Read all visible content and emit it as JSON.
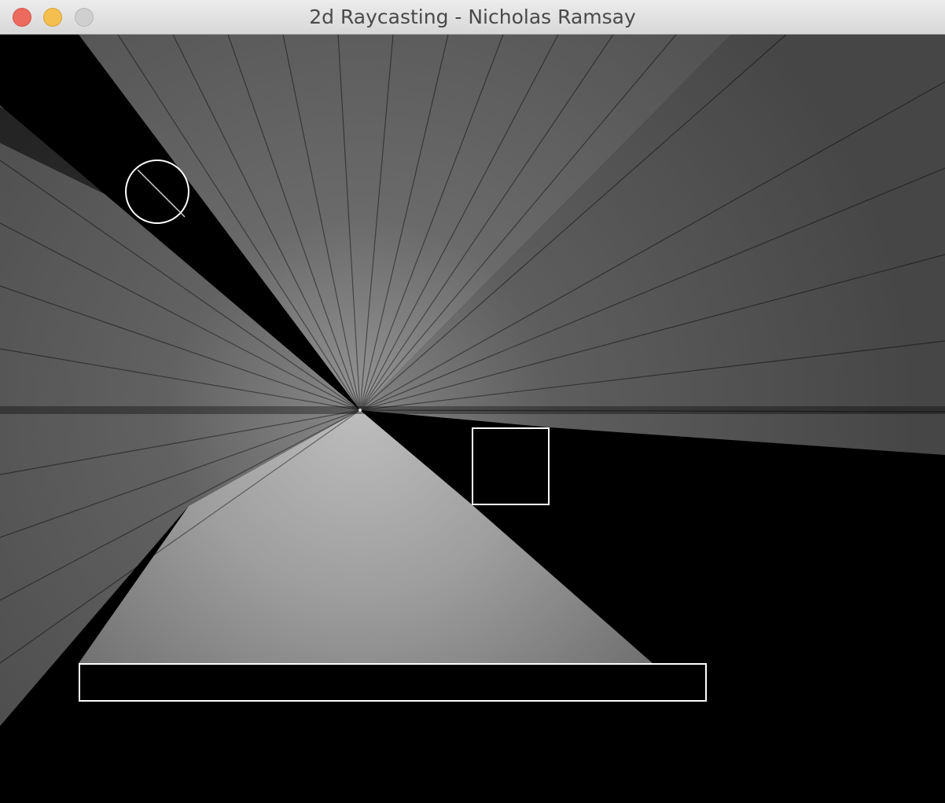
{
  "window": {
    "title": "2d Raycasting - Nicholas Ramsay"
  },
  "colors": {
    "background": "#000000",
    "wall_stroke": "#ffffff",
    "ray_light": "#b4b4b4",
    "ray_mid": "#8c8c8c",
    "ray_dark": "#5a5a5a"
  },
  "scene": {
    "light_source": "ray-origin",
    "shapes": [
      "circle-obstacle",
      "square-obstacle",
      "rectangle-obstacle"
    ]
  }
}
